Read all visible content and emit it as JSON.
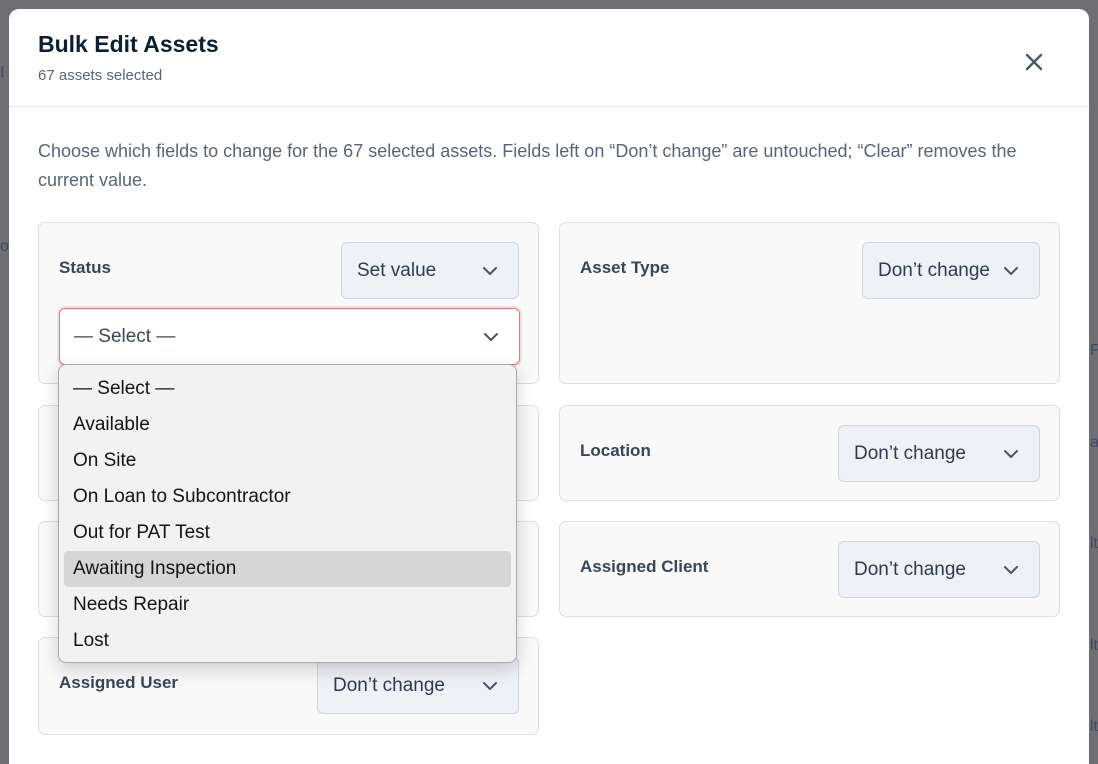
{
  "background": {
    "fragments": [
      "I",
      "o",
      "F",
      "a",
      "lt",
      "lt",
      "lt"
    ]
  },
  "modal": {
    "title": "Bulk Edit Assets",
    "subtitle": "67 assets selected",
    "intro": "Choose which fields to change for the 67 selected assets. Fields left on “Don’t change” are untouched; “Clear” removes the current value.",
    "close_icon": "close-icon"
  },
  "fields": {
    "status": {
      "label": "Status",
      "mode": "Set value",
      "value_placeholder": "— Select —"
    },
    "asset_type": {
      "label": "Asset Type",
      "mode": "Don’t change"
    },
    "location": {
      "label": "Location",
      "mode": "Don’t change"
    },
    "assigned_client": {
      "label": "Assigned Client",
      "mode": "Don’t change"
    },
    "assigned_user": {
      "label": "Assigned User",
      "mode": "Don’t change"
    }
  },
  "status_dropdown": {
    "options": [
      "— Select —",
      "Available",
      "On Site",
      "On Loan to Subcontractor",
      "Out for PAT Test",
      "Awaiting Inspection",
      "Needs Repair",
      "Lost"
    ],
    "highlighted": "Awaiting Inspection"
  },
  "colors": {
    "accent_invalid": "#d97b86",
    "highlight": "#d6d6d7"
  }
}
